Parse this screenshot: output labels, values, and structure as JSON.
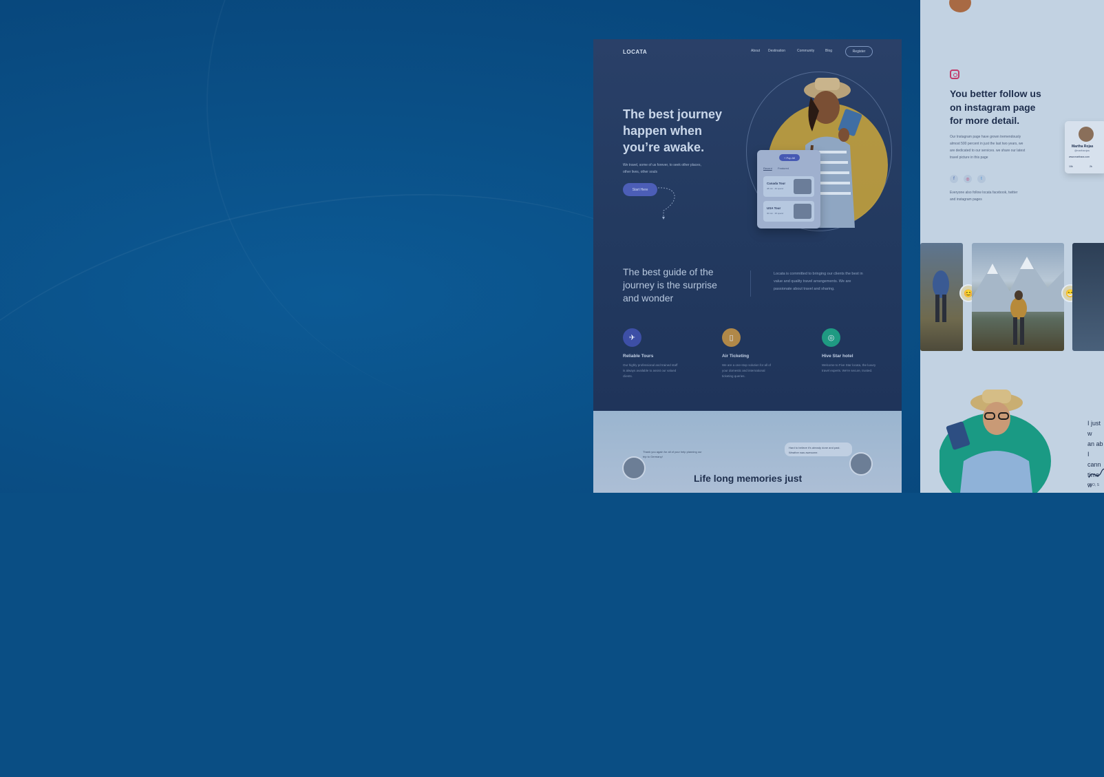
{
  "mockup": {
    "logo": "LOCATA",
    "nav": [
      "About",
      "Destination",
      "Community",
      "Blog"
    ],
    "register": "Register",
    "hero_title": "The best journey happen when you’re awake.",
    "hero_subtitle": "We travel, some of us forever, to seek other places, other lives, other souls",
    "start_button": "Start Here",
    "card": {
      "pill": "+ Pop All",
      "tabs": [
        "Recent",
        "Featured"
      ],
      "tours": [
        {
          "name": "Canada Tour",
          "meta": "48 min · 40 spend"
        },
        {
          "name": "USA Tour",
          "meta": "30 min · 35 spend"
        }
      ]
    },
    "guide_title": "The best guide of the journey is the surprise and wonder",
    "guide_text": "Locata is committed to bringing our clients the best in value and quality travel arrangements. We are passionate about travel and sharing.",
    "features": [
      {
        "title": "Reliable Tours",
        "text": "Our highly professional and trained staff is always available to assist our valued clients.",
        "icon": "plane-icon",
        "color": "#3d4fa6"
      },
      {
        "title": "Air Ticketing",
        "text": "We are a one-stop solution for all of your domestic and international ticketing queries.",
        "icon": "ticket-icon",
        "color": "#b08848"
      },
      {
        "title": "Hive Star hotel",
        "text": "Welcome to Five Star locata, the luxury travel experts. We're secure, trusted.",
        "icon": "target-icon",
        "color": "#1f9a82"
      }
    ],
    "testimonial": {
      "left_quote": "Thank you again for all of your help planning our trip to Germany!",
      "right_quote": "Hard to believe it's already done and past. Weather was awesome.",
      "title": "Life long memories just"
    }
  },
  "right_panel": {
    "instagram_title": "You better follow us on instagram page for more detail.",
    "instagram_text": "Our Instagram page have grown tremendously almost 500 percent in just the last two years, we are dedicated to our services. we share our latest travel picture in this page",
    "social": [
      "f",
      "◎",
      "t"
    ],
    "also_text": "Everyone also follow locata facebook, twitter and instagram pages",
    "profile": {
      "name": "Martha Rojas",
      "handle": "@martharojas",
      "url": "www.marthara.com",
      "stats": [
        "10k",
        "2k"
      ]
    },
    "quote_lines": [
      "I just w",
      "an ab",
      "I cann",
      "time w"
    ],
    "ceo": "CEO, S"
  }
}
